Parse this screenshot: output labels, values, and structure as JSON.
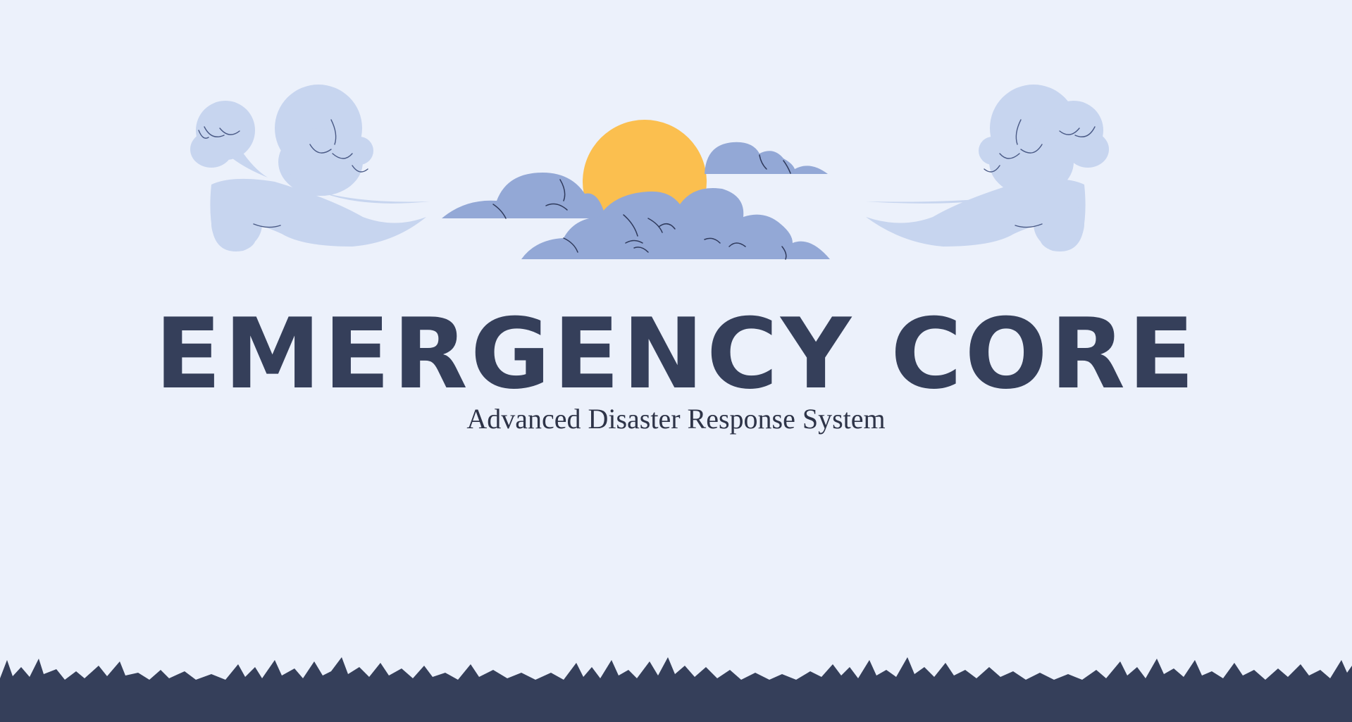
{
  "hero": {
    "title": "EMERGENCY CORE",
    "subtitle": "Advanced Disaster Response System"
  },
  "colors": {
    "background": "#ecf1fb",
    "title": "#353f5a",
    "cloud_dark": "#93a8d6",
    "cloud_light": "#c7d5ef",
    "sun": "#fbbf4f",
    "ground": "#353f5a"
  },
  "icons": {
    "left_wind": "wind-swirl-icon",
    "right_wind": "wind-swirl-icon",
    "sun": "sun-icon",
    "clouds": "cloud-icon",
    "ground": "grass-icon"
  }
}
